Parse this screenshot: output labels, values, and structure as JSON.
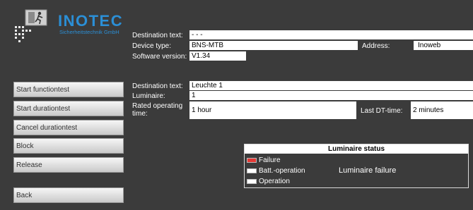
{
  "brand": {
    "name": "INOTEC",
    "subtitle": "Sicherheitstechnik GmbH"
  },
  "device": {
    "destination_label": "Destination text:",
    "destination_value": "- - -",
    "device_type_label": "Device type:",
    "device_type_value": "BNS-MTB",
    "address_label": "Address:",
    "address_value": "Inoweb",
    "software_label": "Software version:",
    "software_value": "V1.34"
  },
  "luminaire": {
    "destination_label": "Destination text:",
    "destination_value": "Leuchte 1",
    "luminaire_label": "Luminaire:",
    "luminaire_value": "1",
    "rated_label": "Rated operating time:",
    "rated_value": "1 hour",
    "last_dt_label": "Last DT-time:",
    "last_dt_value": "2 minutes"
  },
  "buttons": {
    "start_function": "Start functiontest",
    "start_duration": "Start durationtest",
    "cancel_duration": "Cancel durationtest",
    "block": "Block",
    "release": "Release",
    "back": "Back"
  },
  "status": {
    "title": "Luminaire status",
    "legend": [
      {
        "label": "Failure",
        "color": "#e53935"
      },
      {
        "label": "Batt.-operation",
        "color": "#ffffff"
      },
      {
        "label": "Operation",
        "color": "#ffffff"
      }
    ],
    "message": "Luminaire failure"
  },
  "colors": {
    "background": "#3b3b3b",
    "brand_blue": "#2b8fd6",
    "failure_red": "#e53935"
  }
}
